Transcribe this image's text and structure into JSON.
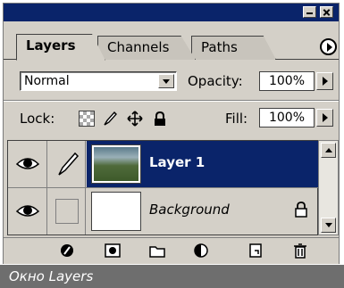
{
  "tabs": [
    {
      "label": "Layers",
      "active": true
    },
    {
      "label": "Channels",
      "active": false
    },
    {
      "label": "Paths",
      "active": false
    }
  ],
  "blend_mode": {
    "value": "Normal"
  },
  "opacity": {
    "label": "Opacity:",
    "value": "100%"
  },
  "lock": {
    "label": "Lock:"
  },
  "fill": {
    "label": "Fill:",
    "value": "100%"
  },
  "layers": [
    {
      "name": "Layer 1",
      "visible": true,
      "selected": true,
      "thumbnail": "photo-icon"
    },
    {
      "name": "Background",
      "visible": true,
      "selected": false,
      "locked": true,
      "thumbnail": "white"
    }
  ],
  "caption": "Окно Layers",
  "colors": {
    "title_bar": "#0a246a",
    "selection": "#0a246a",
    "panel": "#d4d0c8",
    "caption_bg": "#6e6e6e"
  }
}
